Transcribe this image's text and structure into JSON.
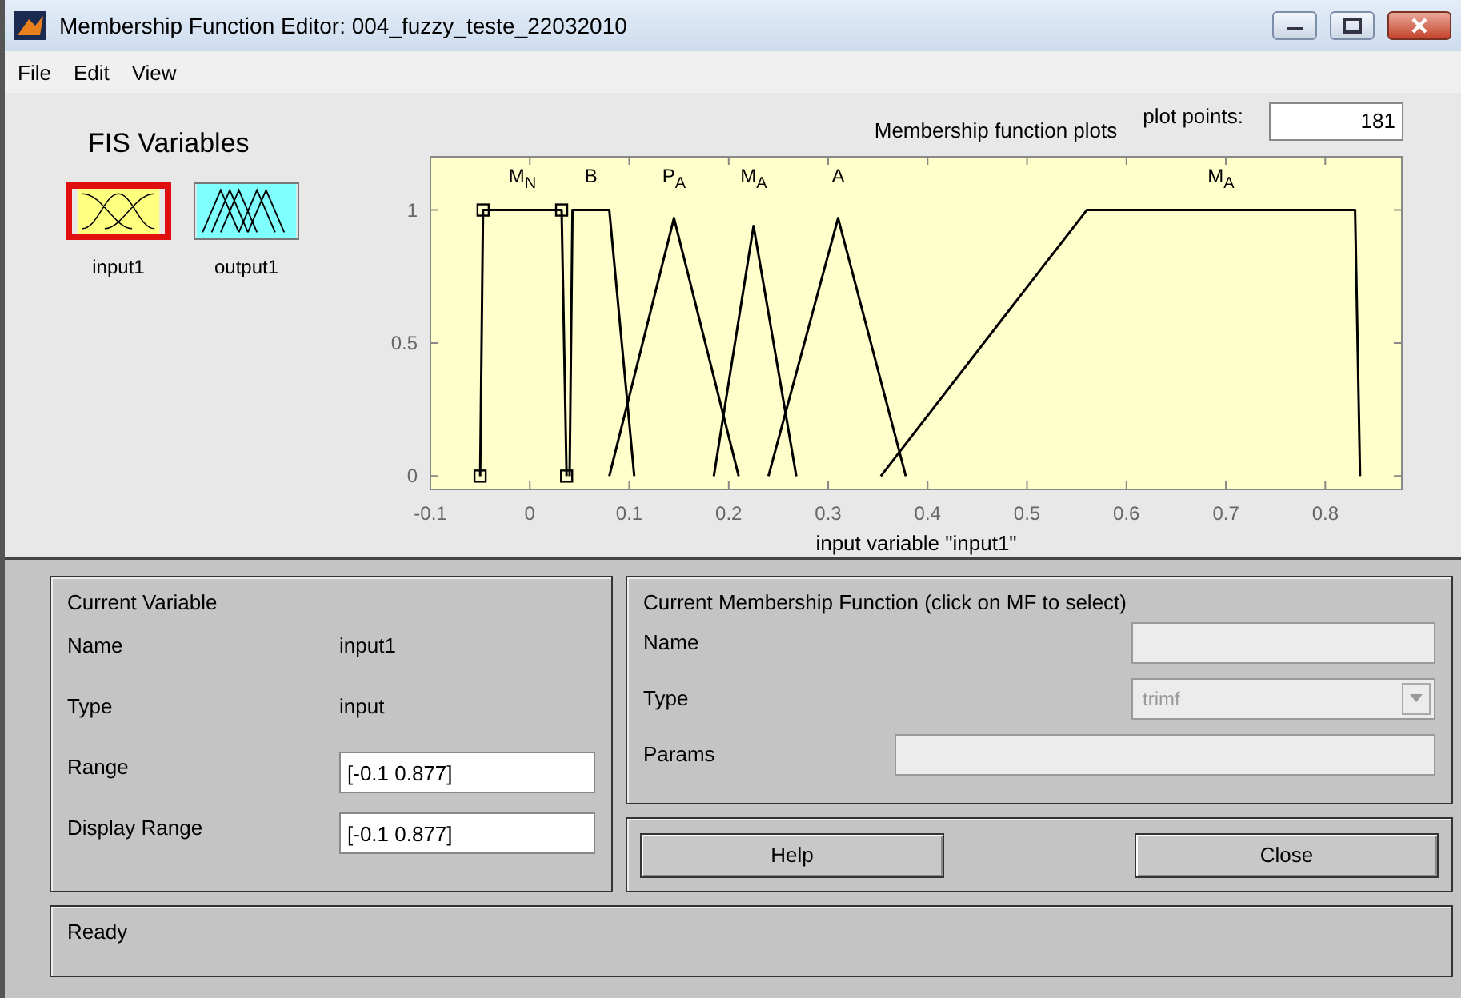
{
  "window": {
    "title": "Membership Function Editor: 004_fuzzy_teste_22032010"
  },
  "menu": [
    "File",
    "Edit",
    "View"
  ],
  "fis_variables": {
    "title": "FIS Variables",
    "items": [
      {
        "label": "input1",
        "kind": "input",
        "selected": true
      },
      {
        "label": "output1",
        "kind": "output",
        "selected": false
      }
    ]
  },
  "plot_points": {
    "label": "plot points:",
    "value": "181"
  },
  "plot": {
    "chart_data": {
      "type": "line",
      "title": "Membership function plots",
      "xlabel": "input variable \"input1\"",
      "x": [
        -0.05,
        -0.047,
        0.032,
        0.037,
        0.04,
        0.043,
        0.08,
        0.105,
        0.145,
        0.185,
        0.21,
        0.225,
        0.24,
        0.268,
        0.31,
        0.353,
        0.378,
        0.56,
        0.83,
        0.835
      ],
      "series": [
        {
          "name": "M$_{N}$",
          "marker": "square",
          "values": [
            0,
            1,
            1,
            0,
            null,
            null,
            null,
            null,
            null,
            null,
            null,
            null,
            null,
            null,
            null,
            null,
            null,
            null,
            null,
            null
          ]
        },
        {
          "name": "B",
          "values": [
            null,
            null,
            null,
            null,
            0,
            1,
            1,
            0,
            null,
            null,
            null,
            null,
            null,
            null,
            null,
            null,
            null,
            null,
            null,
            null
          ]
        },
        {
          "name": "P$_{A}$",
          "values": [
            null,
            null,
            null,
            null,
            null,
            null,
            0,
            null,
            0.97,
            null,
            0,
            null,
            null,
            null,
            null,
            null,
            null,
            null,
            null,
            null
          ]
        },
        {
          "name": "M$_{A}$",
          "values": [
            null,
            null,
            null,
            null,
            null,
            null,
            null,
            null,
            null,
            0,
            null,
            0.94,
            null,
            0,
            null,
            null,
            null,
            null,
            null,
            null
          ]
        },
        {
          "name": "A",
          "values": [
            null,
            null,
            null,
            null,
            null,
            null,
            null,
            null,
            null,
            null,
            null,
            null,
            0,
            null,
            0.97,
            null,
            0,
            null,
            null,
            null
          ]
        },
        {
          "name": "M$_{A}$",
          "values": [
            null,
            null,
            null,
            null,
            null,
            null,
            null,
            null,
            null,
            null,
            null,
            null,
            null,
            null,
            null,
            0,
            null,
            1,
            1,
            0
          ]
        }
      ],
      "xlim": [
        -0.1,
        0.877
      ],
      "ylim": [
        -0.05,
        1.2
      ],
      "xticks": [
        {
          "value": -0.1,
          "label": "-0.1"
        },
        {
          "value": 0,
          "label": "0"
        },
        {
          "value": 0.1,
          "label": "0.1"
        },
        {
          "value": 0.2,
          "label": "0.2"
        },
        {
          "value": 0.3,
          "label": "0.3"
        },
        {
          "value": 0.4,
          "label": "0.4"
        },
        {
          "value": 0.5,
          "label": "0.5"
        },
        {
          "value": 0.6,
          "label": "0.6"
        },
        {
          "value": 0.7,
          "label": "0.7"
        },
        {
          "value": 0.8,
          "label": "0.8"
        }
      ],
      "yticks": [
        {
          "value": 0,
          "label": "0"
        },
        {
          "value": 0.5,
          "label": "0.5"
        },
        {
          "value": 1,
          "label": "1"
        }
      ]
    }
  },
  "current_variable": {
    "title": "Current Variable",
    "rows": [
      {
        "kind": "text",
        "label": "Name",
        "value": "input1"
      },
      {
        "kind": "text",
        "label": "Type",
        "value": "input"
      },
      {
        "kind": "field",
        "label": "Range",
        "value": "[-0.1 0.877]"
      },
      {
        "kind": "field",
        "label": "Display Range",
        "value": "[-0.1 0.877]"
      }
    ]
  },
  "current_mf": {
    "title": "Current Membership Function (click on MF to select)",
    "rows": [
      {
        "kind": "field",
        "label": "Name",
        "disabled": true
      },
      {
        "kind": "dropdown",
        "label": "Type",
        "value": "trimf",
        "disabled": true
      },
      {
        "kind": "wide_field",
        "label": "Params",
        "disabled": true
      }
    ]
  },
  "buttons": [
    "Help",
    "Close"
  ],
  "status_bar": "Ready"
}
